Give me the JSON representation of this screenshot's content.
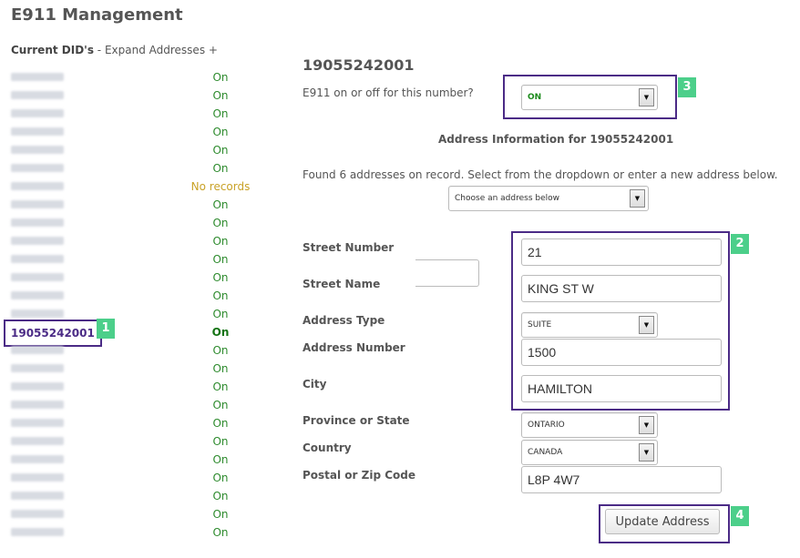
{
  "page_title": "E911 Management",
  "did_header": {
    "label": "Current DID's",
    "separator": " - ",
    "expand_link": "Expand Addresses +"
  },
  "dids": [
    {
      "status": "On"
    },
    {
      "status": "On"
    },
    {
      "status": "On"
    },
    {
      "status": "On"
    },
    {
      "status": "On"
    },
    {
      "status": "On"
    },
    {
      "status": "No records"
    },
    {
      "status": "On"
    },
    {
      "status": "On"
    },
    {
      "status": "On"
    },
    {
      "status": "On"
    },
    {
      "status": "On"
    },
    {
      "status": "On"
    },
    {
      "status": "On"
    },
    {
      "number": "19055242001",
      "status": "On",
      "selected": true
    },
    {
      "status": "On"
    },
    {
      "status": "On"
    },
    {
      "status": "On"
    },
    {
      "status": "On"
    },
    {
      "status": "On"
    },
    {
      "status": "On"
    },
    {
      "status": "On"
    },
    {
      "status": "On"
    },
    {
      "status": "On"
    },
    {
      "status": "On"
    },
    {
      "status": "On"
    }
  ],
  "detail": {
    "did_title": "19055242001",
    "e911_question": "E911 on or off for this number?",
    "e911_value": "ON",
    "address_info_title": "Address Information for 19055242001",
    "found_text": "Found 6 addresses on record. Select from the dropdown or enter a new address below.",
    "address_dropdown_placeholder": "Choose an address below"
  },
  "form": {
    "street_number": {
      "label": "Street Number",
      "value": "21"
    },
    "street_name": {
      "label": "Street Name",
      "value": "KING ST W"
    },
    "address_type": {
      "label": "Address Type",
      "value": "SUITE"
    },
    "address_number": {
      "label": "Address Number",
      "value": "1500"
    },
    "city": {
      "label": "City",
      "value": "HAMILTON"
    },
    "province": {
      "label": "Province or State",
      "value": "ONTARIO"
    },
    "country": {
      "label": "Country",
      "value": "CANADA"
    },
    "postal": {
      "label": "Postal or Zip Code",
      "value": "L8P 4W7"
    }
  },
  "update_button": "Update Address",
  "callouts": [
    "1",
    "2",
    "3",
    "4"
  ],
  "colors": {
    "accent_box": "#4b2b86",
    "callout": "#4ccf8a",
    "status_on": "#2e8b2e",
    "status_none": "#c9a227"
  }
}
